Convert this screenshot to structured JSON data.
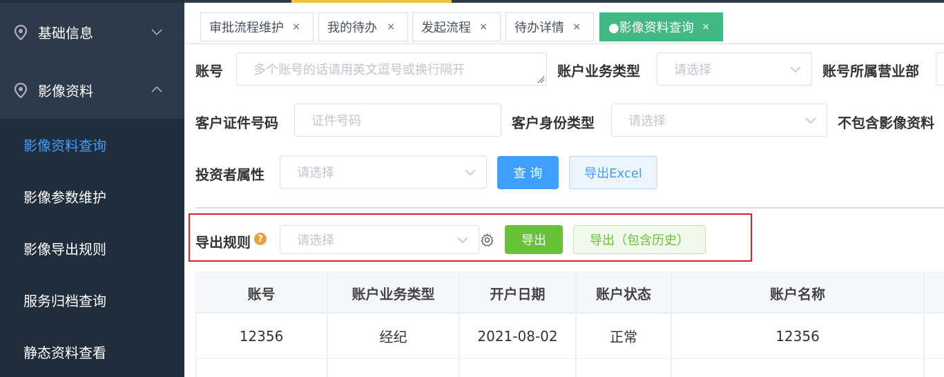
{
  "sidebar": {
    "groups": [
      {
        "label": "基础信息",
        "icon": "location-pin-icon",
        "expanded": false
      },
      {
        "label": "影像资料",
        "icon": "location-pin-icon",
        "expanded": true
      }
    ],
    "items": [
      {
        "label": "影像资料查询",
        "active": true
      },
      {
        "label": "影像参数维护"
      },
      {
        "label": "影像导出规则"
      },
      {
        "label": "服务归档查询"
      },
      {
        "label": "静态资料查看"
      }
    ]
  },
  "tabs": [
    {
      "label": "审批流程维护",
      "close": "×"
    },
    {
      "label": "我的待办",
      "close": "×"
    },
    {
      "label": "发起流程",
      "close": "×"
    },
    {
      "label": "待办详情",
      "close": "×"
    },
    {
      "label": "●影像资料查询",
      "close": "×",
      "active": true
    }
  ],
  "form": {
    "account": {
      "label": "账号",
      "placeholder": "多个账号的话请用英文逗号或换行隔开"
    },
    "business_type": {
      "label": "账户业务类型",
      "placeholder": "请选择"
    },
    "branch": {
      "label": "账号所属营业部"
    },
    "id_number": {
      "label": "客户证件号码",
      "placeholder": "证件号码"
    },
    "identity_type": {
      "label": "客户身份类型",
      "placeholder": "请选择"
    },
    "exclude_images": {
      "label": "不包含影像资料"
    },
    "investor": {
      "label": "投资者属性",
      "placeholder": "请选择"
    },
    "query_button": "查 询",
    "export_excel_button": "导出Excel"
  },
  "export": {
    "rule_label": "导出规则",
    "help": "?",
    "rule_placeholder": "请选择",
    "export_button": "导出",
    "export_history_button": "导出（包含历史）"
  },
  "table": {
    "columns": [
      "账号",
      "账户业务类型",
      "开户日期",
      "账户状态",
      "账户名称"
    ],
    "rows": [
      [
        "12356",
        "经纪",
        "2021-08-02",
        "正常",
        "12356"
      ]
    ]
  },
  "colors": {
    "sidebar_bg": "#1f2d3d",
    "active_menu": "#409eff",
    "active_tab": "#42b983",
    "primary": "#409eff",
    "success": "#67c23a",
    "highlight": "#e02020"
  }
}
